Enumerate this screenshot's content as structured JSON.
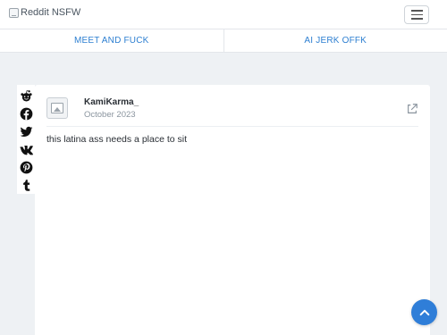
{
  "navbar": {
    "logo_alt": "Reddit NSFW",
    "menu_icon": "hamburger-icon"
  },
  "tabs": [
    {
      "label": "MEET AND FUCK"
    },
    {
      "label": "AI JERK OFFK"
    }
  ],
  "share_icons": [
    "reddit-icon",
    "facebook-icon",
    "twitter-icon",
    "vk-icon",
    "pinterest-icon",
    "tumblr-icon"
  ],
  "post": {
    "username": "KamiKarma_",
    "date": "October 2023",
    "text": "this latina ass needs a place to sit",
    "share_icon": "share-arrow-icon"
  },
  "scroll_top_icon": "chevron-up-icon",
  "colors": {
    "accent": "#2f7ed8",
    "tab_text": "#2d7fd1",
    "background": "#eef1f4"
  }
}
